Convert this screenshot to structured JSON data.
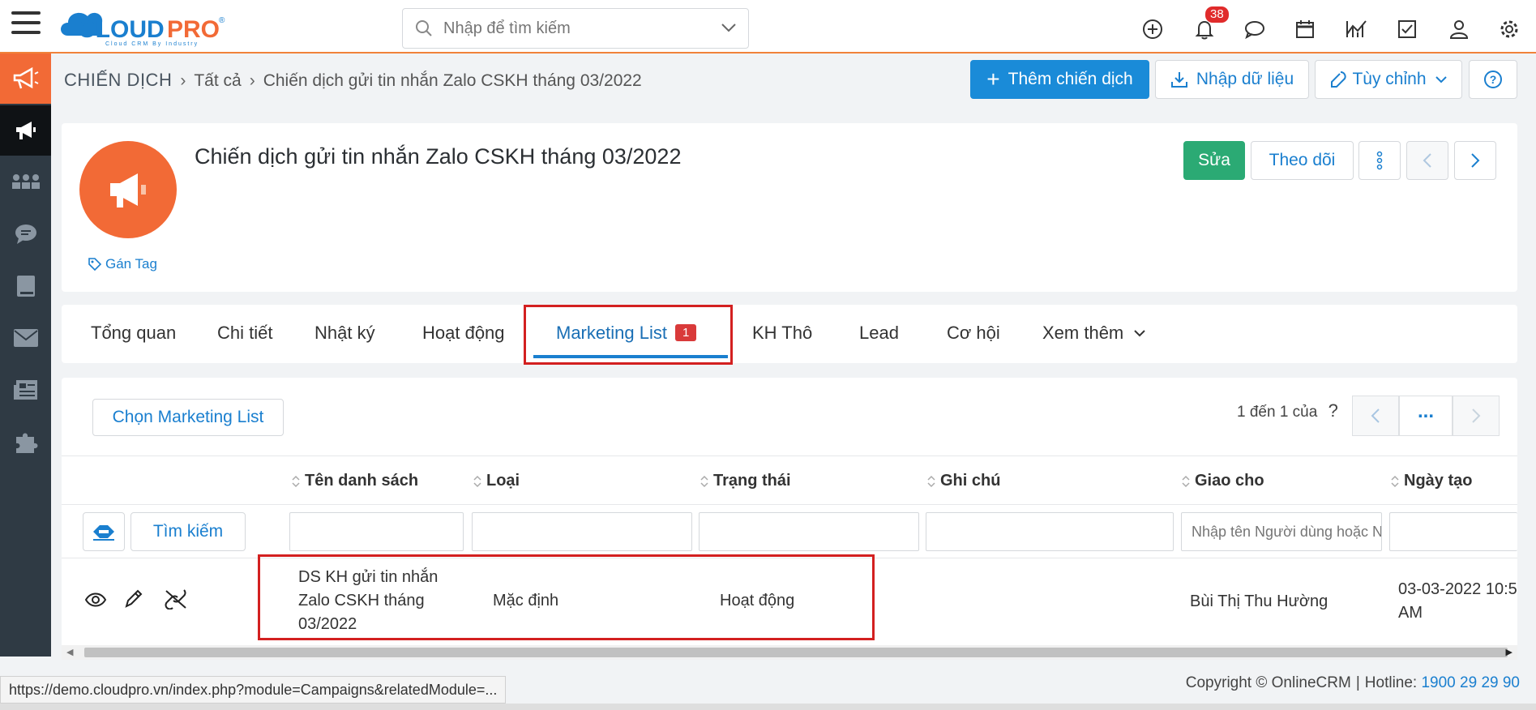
{
  "brand": {
    "name": "CLOUDPRO",
    "tagline": "Cloud CRM By Industry",
    "color": "#1a7fcf",
    "accent": "#f26a36"
  },
  "search": {
    "placeholder": "Nhập để tìm kiếm"
  },
  "notifications": {
    "count": "38"
  },
  "breadcrumb": {
    "root": "CHIẾN DỊCH",
    "level1": "Tất cả",
    "current": "Chiến dịch gửi tin nhắn Zalo CSKH tháng 03/2022"
  },
  "header_actions": {
    "add": "Thêm chiến dịch",
    "import": "Nhập dữ liệu",
    "customize": "Tùy chỉnh"
  },
  "record": {
    "title": "Chiến dịch gửi tin nhắn Zalo CSKH tháng 03/2022",
    "tag_label": "Gán Tag",
    "edit": "Sửa",
    "follow": "Theo dõi"
  },
  "tabs": [
    {
      "label": "Tổng quan"
    },
    {
      "label": "Chi tiết"
    },
    {
      "label": "Nhật ký"
    },
    {
      "label": "Hoạt động"
    },
    {
      "label": "Marketing List",
      "badge": "1",
      "active": true
    },
    {
      "label": "KH Thô"
    },
    {
      "label": "Lead"
    },
    {
      "label": "Cơ hội"
    },
    {
      "label": "Xem thêm"
    }
  ],
  "related": {
    "select_button": "Chọn Marketing List",
    "pager_text": "1 đến 1 của",
    "pager_help": "?",
    "pager_more": "...",
    "search_button": "Tìm kiếm",
    "columns": [
      "Tên danh sách",
      "Loại",
      "Trạng thái",
      "Ghi chú",
      "Giao cho",
      "Ngày tạo"
    ],
    "assignee_placeholder": "Nhập tên Người dùng hoặc Nhóm",
    "rows": [
      {
        "name_line1": "DS KH gửi tin nhắn",
        "name_line2": "Zalo CSKH tháng",
        "name_line3": "03/2022",
        "type": "Mặc định",
        "status": "Hoạt động",
        "note": "",
        "assignee": "Bùi Thị Thu Hường",
        "created_line1": "03-03-2022 10:5",
        "created_line2": "AM"
      }
    ]
  },
  "footer": {
    "copyright": "Copyright © OnlineCRM",
    "hotline_label": "Hotline:",
    "hotline": "1900 29 29 90"
  },
  "status_url": "https://demo.cloudpro.vn/index.php?module=Campaigns&relatedModule=..."
}
